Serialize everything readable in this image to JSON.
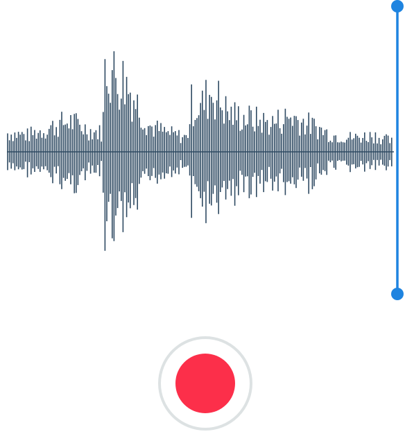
{
  "colors": {
    "waveform": "#2e4a62",
    "playhead": "#1f84e0",
    "record_fill": "#fc2f4a",
    "record_ring": "#dde2e3",
    "background": "#ffffff"
  },
  "icons": {
    "record": "record-circle-icon",
    "playhead_top": "playhead-top-handle-icon",
    "playhead_bottom": "playhead-bottom-handle-icon"
  }
}
